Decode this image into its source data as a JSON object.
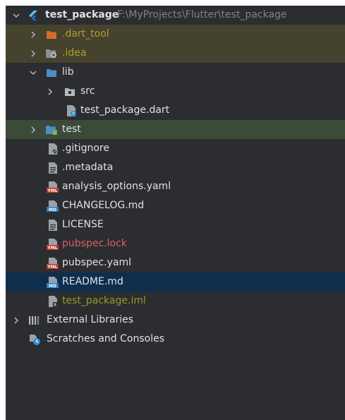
{
  "colors": {
    "folder": "#4a8fc8",
    "excluded_folder": "#d66a2a",
    "excluded_text": "#b59e2a",
    "red_text": "#d96060",
    "iml_text": "#9a9a2a",
    "selected_bg": "#0f2e4d"
  },
  "tree": {
    "project": {
      "name": "test_package",
      "path": "F:\\MyProjects\\Flutter\\test_package",
      "icon": "flutter-icon"
    },
    "dart_tool": {
      "name": ".dart_tool",
      "icon": "folder-icon"
    },
    "idea": {
      "name": ".idea",
      "icon": "settings-folder-icon"
    },
    "lib": {
      "name": "lib",
      "icon": "folder-icon"
    },
    "src": {
      "name": "src",
      "icon": "package-icon"
    },
    "test_package_dart": {
      "name": "test_package.dart",
      "icon": "dart-file-icon"
    },
    "test": {
      "name": "test",
      "icon": "test-folder-icon"
    },
    "gitignore": {
      "name": ".gitignore",
      "icon": "ignore-file-icon"
    },
    "metadata": {
      "name": ".metadata",
      "icon": "text-file-icon"
    },
    "analysis_options": {
      "name": "analysis_options.yaml",
      "icon": "yaml-file-icon"
    },
    "changelog": {
      "name": "CHANGELOG.md",
      "icon": "markdown-file-icon"
    },
    "license": {
      "name": "LICENSE",
      "icon": "text-file-icon"
    },
    "pubspec_lock": {
      "name": "pubspec.lock",
      "icon": "yaml-file-icon"
    },
    "pubspec_yaml": {
      "name": "pubspec.yaml",
      "icon": "yaml-file-icon"
    },
    "readme": {
      "name": "README.md",
      "icon": "markdown-file-icon"
    },
    "iml": {
      "name": "test_package.iml",
      "icon": "module-file-icon"
    },
    "external_libraries": {
      "name": "External Libraries",
      "icon": "libraries-icon"
    },
    "scratches": {
      "name": "Scratches and Consoles",
      "icon": "scratches-icon"
    }
  }
}
